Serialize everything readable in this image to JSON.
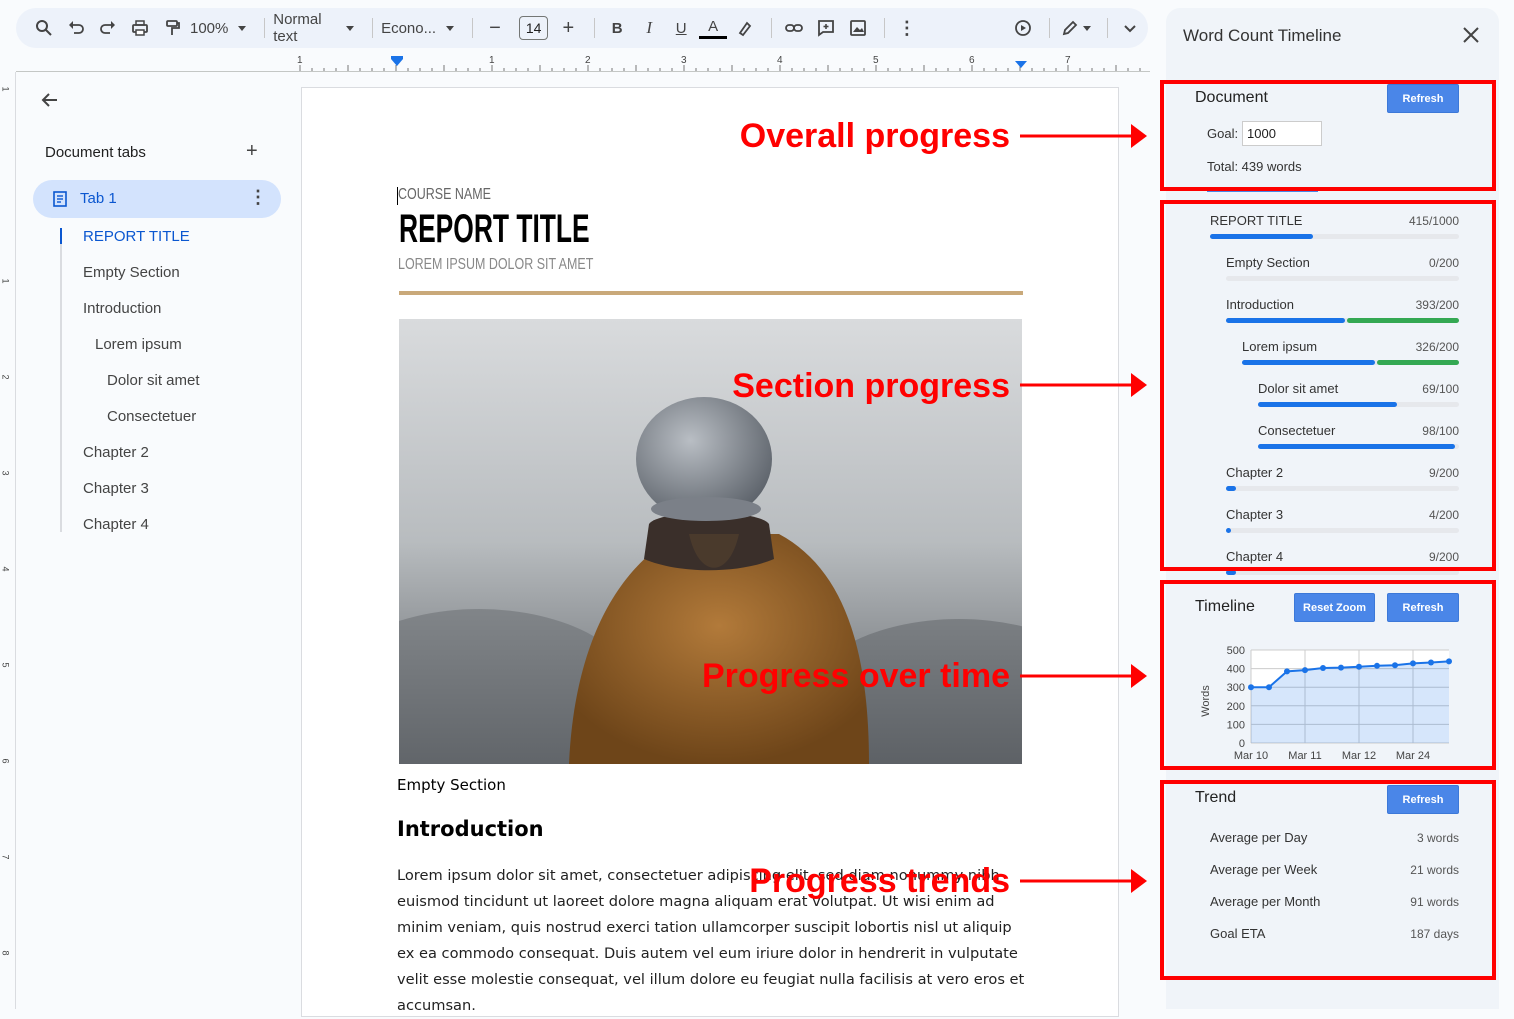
{
  "toolbar": {
    "zoom": "100%",
    "style": "Normal text",
    "font": "Econo...",
    "font_size": "14"
  },
  "sidebar": {
    "title": "Document tabs",
    "tab_label": "Tab 1",
    "outline": [
      "REPORT TITLE",
      "Empty Section",
      "Introduction",
      "Lorem ipsum",
      "Dolor sit amet",
      "Consectetuer",
      "Chapter 2",
      "Chapter 3",
      "Chapter 4"
    ]
  },
  "ruler": {
    "top_numbers": [
      "1",
      "1",
      "2",
      "3",
      "4",
      "5",
      "6",
      "7"
    ],
    "left_numbers": [
      "1",
      "1",
      "2",
      "3",
      "4",
      "5",
      "6",
      "7",
      "8"
    ]
  },
  "document": {
    "course": "COURSE NAME",
    "title": "REPORT TITLE",
    "subtitle": "LOREM IPSUM DOLOR SIT AMET",
    "empty_section": "Empty Section",
    "intro_heading": "Introduction",
    "body": "Lorem ipsum dolor sit amet, consectetuer adipiscing elit, sed diam nonummy nibh euismod tincidunt ut laoreet dolore magna aliquam erat volutpat. Ut wisi enim ad minim veniam, quis nostrud exerci tation ullamcorper suscipit lobortis nisl ut aliquip ex ea commodo consequat. Duis autem vel eum iriure dolor in hendrerit in vulputate velit esse molestie consequat, vel illum dolore eu feugiat nulla facilisis at vero eros et accumsan."
  },
  "panel": {
    "title": "Word Count Timeline",
    "document": {
      "heading": "Document",
      "refresh": "Refresh",
      "goal_label": "Goal:",
      "goal_value": "1000",
      "total": "Total: 439 words"
    },
    "sections": [
      {
        "name": "REPORT TITLE",
        "count": "415/1000",
        "progress": 0.415
      },
      {
        "name": "Empty Section",
        "count": "0/200",
        "progress": 0
      },
      {
        "name": "Introduction",
        "count": "393/200",
        "progress": 1.965
      },
      {
        "name": "Lorem ipsum",
        "count": "326/200",
        "progress": 1.63
      },
      {
        "name": "Dolor sit amet",
        "count": "69/100",
        "progress": 0.69
      },
      {
        "name": "Consectetuer",
        "count": "98/100",
        "progress": 0.98
      },
      {
        "name": "Chapter 2",
        "count": "9/200",
        "progress": 0.045
      },
      {
        "name": "Chapter 3",
        "count": "4/200",
        "progress": 0.02
      },
      {
        "name": "Chapter 4",
        "count": "9/200",
        "progress": 0.045
      }
    ],
    "timeline": {
      "heading": "Timeline",
      "reset_zoom": "Reset Zoom",
      "refresh": "Refresh"
    },
    "trend": {
      "heading": "Trend",
      "refresh": "Refresh",
      "rows": [
        {
          "label": "Average per Day",
          "value": "3 words"
        },
        {
          "label": "Average per Week",
          "value": "21 words"
        },
        {
          "label": "Average per Month",
          "value": "91 words"
        },
        {
          "label": "Goal ETA",
          "value": "187 days"
        }
      ]
    }
  },
  "annotations": {
    "overall": "Overall progress",
    "section": "Section progress",
    "time": "Progress over time",
    "trends": "Progress trends"
  },
  "chart_data": {
    "type": "area",
    "ylabel": "Words",
    "ylim": [
      0,
      500
    ],
    "yticks": [
      "0",
      "100",
      "200",
      "300",
      "400",
      "500"
    ],
    "xticks": [
      "Mar 10",
      "Mar 11",
      "Mar 12",
      "Mar 24"
    ],
    "values": [
      300,
      300,
      385,
      392,
      403,
      405,
      410,
      415,
      418,
      428,
      433,
      439
    ],
    "color": "#1a73e8",
    "grid": true
  }
}
